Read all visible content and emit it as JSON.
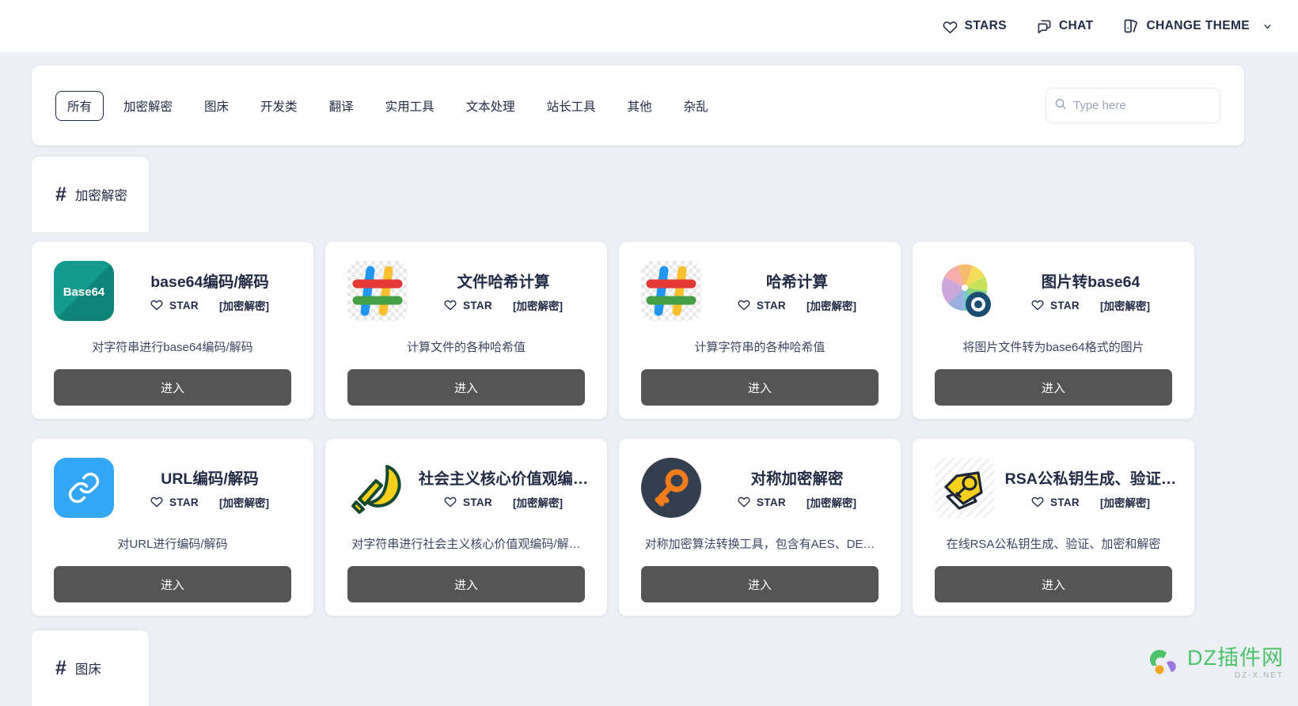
{
  "topbar": {
    "items": [
      {
        "icon": "heart-icon",
        "label": "STARS"
      },
      {
        "icon": "chat-icon",
        "label": "CHAT"
      },
      {
        "icon": "theme-icon",
        "label": "CHANGE THEME",
        "caret": "chevron-down-icon"
      }
    ]
  },
  "filter": {
    "tabs": [
      {
        "label": "所有",
        "active": true
      },
      {
        "label": "加密解密",
        "active": false
      },
      {
        "label": "图床",
        "active": false
      },
      {
        "label": "开发类",
        "active": false
      },
      {
        "label": "翻译",
        "active": false
      },
      {
        "label": "实用工具",
        "active": false
      },
      {
        "label": "文本处理",
        "active": false
      },
      {
        "label": "站长工具",
        "active": false
      },
      {
        "label": "其他",
        "active": false
      },
      {
        "label": "杂乱",
        "active": false
      }
    ],
    "search": {
      "placeholder": "Type here",
      "value": "",
      "icon": "search-icon"
    }
  },
  "sections": [
    {
      "hash": "#",
      "name": "加密解密"
    },
    {
      "hash": "#",
      "name": "图床"
    }
  ],
  "cards": [
    {
      "title": "base64编码/解码",
      "star_label": "STAR",
      "category": "[加密解密]",
      "desc": "对字符串进行base64编码/解码",
      "button": "进入",
      "icon": "base64-logo-icon"
    },
    {
      "title": "文件哈希计算",
      "star_label": "STAR",
      "category": "[加密解密]",
      "desc": "计算文件的各种哈希值",
      "button": "进入",
      "icon": "hash-colored-icon"
    },
    {
      "title": "哈希计算",
      "star_label": "STAR",
      "category": "[加密解密]",
      "desc": "计算字符串的各种哈希值",
      "button": "进入",
      "icon": "hash-colored-icon"
    },
    {
      "title": "图片转base64",
      "star_label": "STAR",
      "category": "[加密解密]",
      "desc": "将图片文件转为base64格式的图片",
      "button": "进入",
      "icon": "color-wheel-photo-icon"
    },
    {
      "title": "URL编码/解码",
      "star_label": "STAR",
      "category": "[加密解密]",
      "desc": "对URL进行编码/解码",
      "button": "进入",
      "icon": "link-chain-icon"
    },
    {
      "title": "社会主义核心价值观编…",
      "star_label": "STAR",
      "category": "[加密解密]",
      "desc": "对字符串进行社会主义核心价值观编码/解…",
      "button": "进入",
      "icon": "hammer-sickle-icon"
    },
    {
      "title": "对称加密解密",
      "star_label": "STAR",
      "category": "[加密解密]",
      "desc": "对称加密算法转换工具，包含有AES、DE…",
      "button": "进入",
      "icon": "key-circle-icon"
    },
    {
      "title": "RSA公私钥生成、验证…",
      "star_label": "STAR",
      "category": "[加密解密]",
      "desc": "在线RSA公私钥生成、验证、加密和解密",
      "button": "进入",
      "icon": "key-tag-icon"
    }
  ],
  "watermark": {
    "main": "DZ插件网",
    "sub": "DZ-X.NET"
  },
  "colors": {
    "accent": "#222b45",
    "button": "#555555",
    "page_bg": "#eceff3",
    "card_bg": "#ffffff",
    "watermark_green": "#4cc36a"
  }
}
